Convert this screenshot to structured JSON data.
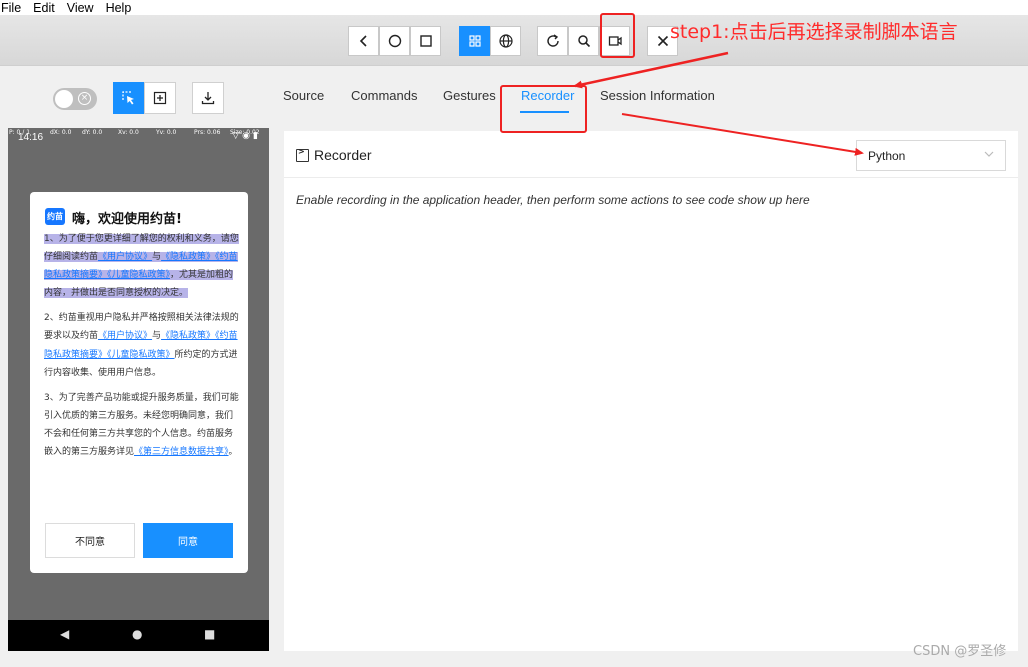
{
  "menu": [
    "File",
    "Edit",
    "View",
    "Help"
  ],
  "toolbar": {
    "buttons": [
      {
        "name": "back-button",
        "icon": "chevron-left-icon"
      },
      {
        "name": "home-button",
        "icon": "circle-icon"
      },
      {
        "name": "app-switch-button",
        "icon": "square-icon"
      },
      {
        "name": "native-mode-button",
        "icon": "grid-icon"
      },
      {
        "name": "web-mode-button",
        "icon": "globe-icon"
      },
      {
        "name": "refresh-button",
        "icon": "refresh-icon"
      },
      {
        "name": "search-button",
        "icon": "search-icon"
      },
      {
        "name": "record-button",
        "icon": "video-camera-icon"
      },
      {
        "name": "quit-session-button",
        "icon": "close-icon"
      }
    ]
  },
  "tabs": [
    "Source",
    "Commands",
    "Gestures",
    "Recorder",
    "Session Information"
  ],
  "active_tab": "Recorder",
  "device": {
    "time": "14:16",
    "coords": [
      "P: 0 / 1",
      "dX: 0.0",
      "dY: 0.0",
      "Xv: 0.0",
      "Yv: 0.0",
      "Prs: 0.06",
      "Size: 0.02"
    ],
    "dialog": {
      "logo": "约苗",
      "title": "嗨，欢迎使用约苗!",
      "p1": {
        "t1": "1、为了便于您更详细了解您的权利和义务，请您仔细阅读约苗",
        "l1": "《用户协议》",
        "and": "与",
        "l2": "《隐私政策》《约苗隐私政策摘要》《儿童隐私政策》",
        "t2": "，尤其是加粗的内容，并做出是否同意授权的决定。"
      },
      "p2": {
        "t1": "2、约苗重视用户隐私并严格按照相关法律法规的要求以及约苗",
        "l1": "《用户协议》",
        "and": "与",
        "l2": "《隐私政策》《约苗隐私政策摘要》《儿童隐私政策》",
        "t2": "所约定的方式进行内容收集、使用用户信息。"
      },
      "p3": {
        "t1": "3、为了完善产品功能或提升服务质量，我们可能引入优质的第三方服务。未经您明确同意，我们不会和任何第三方共享您的个人信息。约苗服务嵌入的第三方服务详见",
        "l1": "《第三方信息数据共享》",
        "t2": "。"
      },
      "disagree": "不同意",
      "agree": "同意"
    },
    "nav": [
      "◀",
      "●",
      "■"
    ]
  },
  "recorder": {
    "title": "Recorder",
    "language": "Python",
    "message": "Enable recording in the application header, then perform some actions to see code show up here"
  },
  "annotation": "step1:点击后再选择录制脚本语言",
  "watermark": "CSDN @罗圣修",
  "colors": {
    "accent": "#1890ff",
    "annotation": "#ee2222"
  }
}
